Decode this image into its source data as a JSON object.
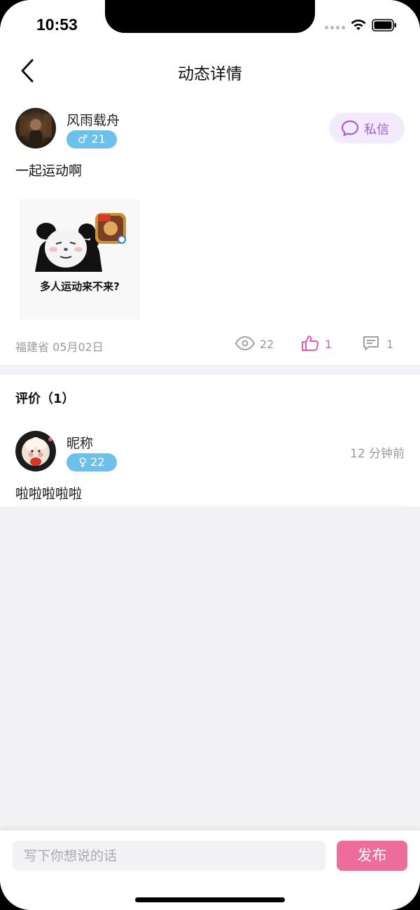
{
  "status_bar": {
    "time": "10:53"
  },
  "nav": {
    "title": "动态详情",
    "back_icon": "chevron-left-icon"
  },
  "post": {
    "author": {
      "name": "风雨载舟",
      "gender_symbol": "♂",
      "age": "21",
      "badge_text": "♂ 21"
    },
    "dm_button_label": "私信",
    "text": "一起运动啊",
    "image_caption": "多人运动来不来?",
    "location_date": "福建省 05月02日",
    "stats": {
      "views": "22",
      "likes": "1",
      "comments": "1"
    }
  },
  "comments_section": {
    "header": "评价（1）",
    "items": [
      {
        "name": "昵称",
        "badge_text": "♀ 22",
        "time": "12 分钟前",
        "text": "啦啦啦啦啦"
      }
    ]
  },
  "bottom_bar": {
    "input_placeholder": "写下你想说的话",
    "publish_label": "发布"
  },
  "colors": {
    "accent_pink": "#ec6c9a",
    "badge_blue": "#6dc0ec",
    "dm_purple": "#a45ee0",
    "dm_bg": "#f3eafc",
    "page_bg": "#f2f2f6"
  }
}
